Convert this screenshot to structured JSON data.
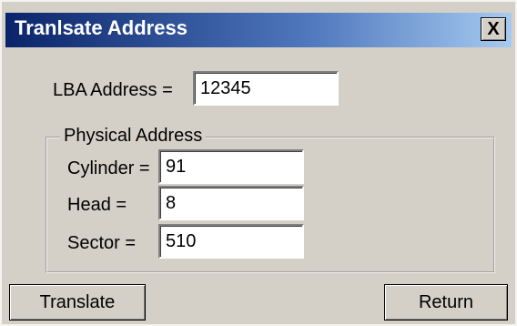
{
  "window": {
    "title": "Tranlsate Address",
    "close_label": "X"
  },
  "lba": {
    "label": "LBA Address =",
    "value": "12345"
  },
  "physical": {
    "group_label": "Physical Address",
    "cylinder": {
      "label": "Cylinder =",
      "value": "91"
    },
    "head": {
      "label": "Head =",
      "value": "8"
    },
    "sector": {
      "label": "Sector =",
      "value": "510"
    }
  },
  "buttons": {
    "translate_label": "Translate",
    "return_label": "Return"
  }
}
